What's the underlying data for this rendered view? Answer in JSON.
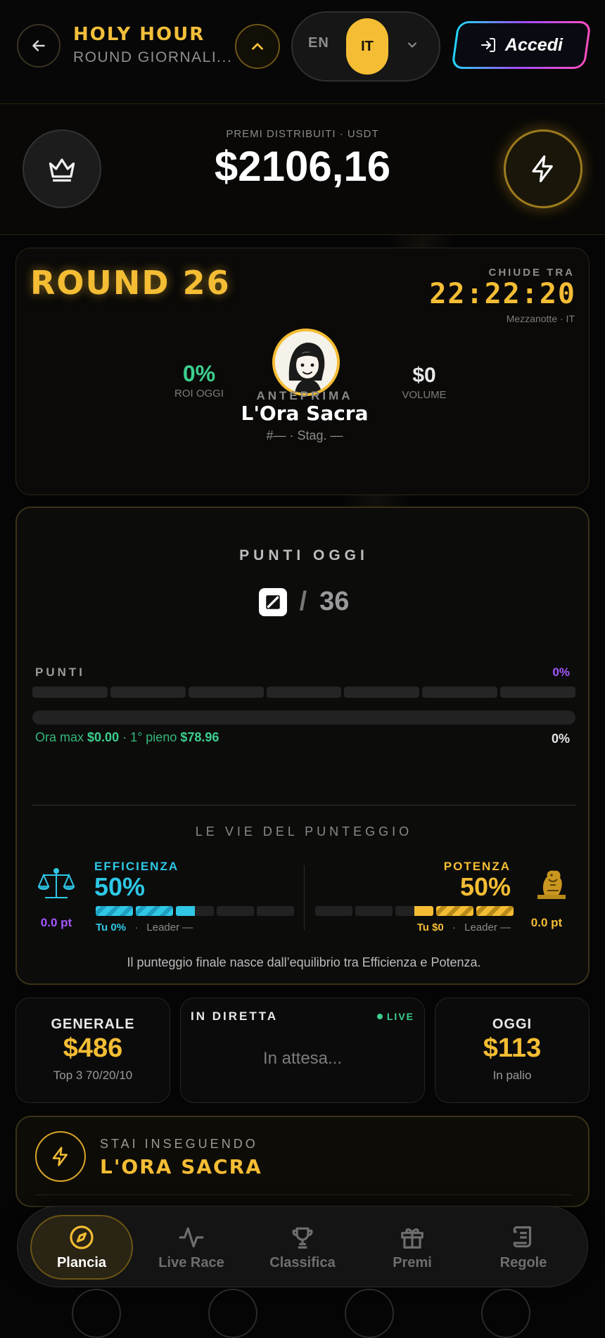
{
  "header": {
    "title": "HOLY HOUR",
    "subtitle": "ROUND GIORNALI...",
    "lang_en": "EN",
    "lang_it": "IT",
    "login_label": "Accedi"
  },
  "prize": {
    "label": "PREMI DISTRIBUITI · USDT",
    "value": "$2106,16"
  },
  "round": {
    "title": "ROUND 26",
    "closes_label": "CHIUDE TRA",
    "timer": "22:22:20",
    "timer_sub": "Mezzanotte · IT",
    "roi_value": "0%",
    "roi_label": "ROI OGGI",
    "volume_value": "$0",
    "volume_label": "VOLUME",
    "preview_label": "ANTEPRIMA",
    "player_name": "L'Ora Sacra",
    "player_meta": "#— · Stag. —"
  },
  "points": {
    "title": "PUNTI OGGI",
    "total": "36",
    "bar_label": "PUNTI",
    "bar_pct": "0%",
    "ora_max_label": "Ora max",
    "ora_max_value": "$0.00",
    "first_full_label": "· 1° pieno",
    "first_full_value": "$78.96",
    "progress_pct": "0%",
    "ways_title": "LE VIE DEL PUNTEGGIO",
    "efficiency": {
      "label": "EFFICIENZA",
      "value": "50%",
      "you_label": "Tu 0%",
      "leader_label": "Leader —",
      "points": "0.0 pt",
      "fill": 0.5
    },
    "power": {
      "label": "POTENZA",
      "value": "50%",
      "you_label": "Tu $0",
      "leader_label": "Leader —",
      "points": "0.0 pt",
      "fill": 0.5
    },
    "footnote": "Il punteggio finale nasce dall’equilibrio tra Efficienza e Potenza."
  },
  "stats": {
    "general": {
      "label": "GENERALE",
      "value": "$486",
      "sub": "Top 3 70/20/10"
    },
    "live": {
      "label": "IN DIRETTA",
      "badge": "LIVE",
      "waiting": "In attesa..."
    },
    "today": {
      "label": "OGGI",
      "value": "$113",
      "sub": "In palio"
    }
  },
  "chase": {
    "label": "STAI INSEGUENDO",
    "name": "L'ORA SACRA"
  },
  "nav": [
    {
      "label": "Plancia",
      "icon": "compass-icon"
    },
    {
      "label": "Live Race",
      "icon": "pulse-icon"
    },
    {
      "label": "Classifica",
      "icon": "trophy-icon"
    },
    {
      "label": "Premi",
      "icon": "gift-icon"
    },
    {
      "label": "Regole",
      "icon": "scroll-icon"
    }
  ],
  "colors": {
    "accent_gold": "#f4bd34",
    "efficiency_cyan": "#2ec8e6",
    "positive_green": "#3ccf8e",
    "points_purple": "#a457ff"
  }
}
